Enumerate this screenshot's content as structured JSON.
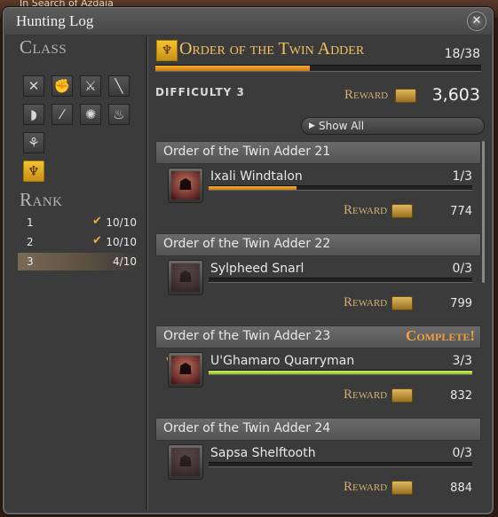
{
  "background": {
    "behind_text": "In Search of Azdaja"
  },
  "window": {
    "title": "Hunting Log",
    "close_glyph": "✕"
  },
  "left": {
    "class_header": "Class",
    "classes": [
      {
        "icon": "gladiator-crossed-swords-icon",
        "glyph": "✕",
        "selected": false
      },
      {
        "icon": "pugilist-fist-icon",
        "glyph": "✊",
        "selected": false
      },
      {
        "icon": "marauder-axes-icon",
        "glyph": "⚔",
        "selected": false
      },
      {
        "icon": "lancer-spear-icon",
        "glyph": "╲",
        "selected": false
      },
      {
        "icon": "archer-bow-icon",
        "glyph": "◗",
        "selected": false
      },
      {
        "icon": "rogue-daggers-icon",
        "glyph": "⁄",
        "selected": false
      },
      {
        "icon": "thaumaturge-icon",
        "glyph": "✺",
        "selected": false
      },
      {
        "icon": "conjurer-flame-icon",
        "glyph": "♨",
        "selected": false
      },
      {
        "icon": "arcanist-icon",
        "glyph": "⚘",
        "selected": false
      },
      {
        "icon": "grand-company-twin-adder-icon",
        "glyph": "♆",
        "selected": true
      }
    ],
    "rank_header": "Rank",
    "ranks": [
      {
        "num": "1",
        "progress": "10/10",
        "check": "✔",
        "selected": false
      },
      {
        "num": "2",
        "progress": "10/10",
        "check": "✔",
        "selected": false
      },
      {
        "num": "3",
        "progress": "4/10",
        "check": "",
        "selected": true
      }
    ]
  },
  "right": {
    "header": {
      "icon": "twin-adder-icon",
      "glyph": "♆",
      "name": "Order of the Twin Adder",
      "progress": "18/38",
      "progress_fraction": 0.474
    },
    "difficulty": "DIFFICULTY 3",
    "reward_label": "Reward",
    "reward_value": "3,603",
    "show_all_glyph": "▶",
    "show_all": "Show All",
    "sections": [
      {
        "title": "Order of the Twin Adder 21",
        "complete": "",
        "monster": {
          "icon": "ixali-monster-icon",
          "glyph": "☗",
          "name": "Ixali Windtalon",
          "count": "1/3",
          "fraction": 0.333,
          "check": "",
          "done": true
        },
        "reward": "774"
      },
      {
        "title": "Order of the Twin Adder 22",
        "complete": "",
        "monster": {
          "icon": "sylph-monster-icon",
          "glyph": "☗",
          "name": "Sylpheed Snarl",
          "count": "0/3",
          "fraction": 0,
          "check": "",
          "done": false
        },
        "reward": "799"
      },
      {
        "title": "Order of the Twin Adder 23",
        "complete": "Complete!",
        "monster": {
          "icon": "kobold-monster-icon",
          "glyph": "☗",
          "name": "U'Ghamaro Quarryman",
          "count": "3/3",
          "fraction": 1,
          "check": "✔",
          "done": true
        },
        "reward": "832"
      },
      {
        "title": "Order of the Twin Adder 24",
        "complete": "",
        "monster": {
          "icon": "amaljaa-monster-icon",
          "glyph": "☗",
          "name": "Sapsa Shelftooth",
          "count": "0/3",
          "fraction": 0,
          "check": "",
          "done": false
        },
        "reward": "884"
      }
    ]
  },
  "colors": {
    "accent_gold": "#f0c060",
    "progress_orange": "#e89a20",
    "progress_green": "#b8e040",
    "complete_orange": "#f0a040"
  }
}
